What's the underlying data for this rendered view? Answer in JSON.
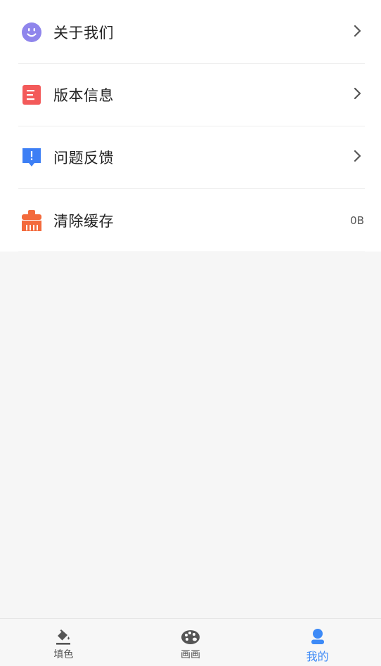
{
  "menu": {
    "items": [
      {
        "label": "关于我们",
        "icon": "smiley-icon",
        "color": "#8f85ec",
        "value": ""
      },
      {
        "label": "版本信息",
        "icon": "document-icon",
        "color": "#f35a5a",
        "value": ""
      },
      {
        "label": "问题反馈",
        "icon": "feedback-icon",
        "color": "#3d7ff5",
        "value": ""
      },
      {
        "label": "清除缓存",
        "icon": "brush-icon",
        "color": "#f36a3c",
        "value": "0B"
      }
    ]
  },
  "tabbar": {
    "tabs": [
      {
        "label": "填色",
        "icon": "paint-bucket-icon",
        "active": false
      },
      {
        "label": "画画",
        "icon": "palette-icon",
        "active": false
      },
      {
        "label": "我的",
        "icon": "person-icon",
        "active": true
      }
    ],
    "active_color": "#3d8af7",
    "inactive_color": "#555555"
  }
}
